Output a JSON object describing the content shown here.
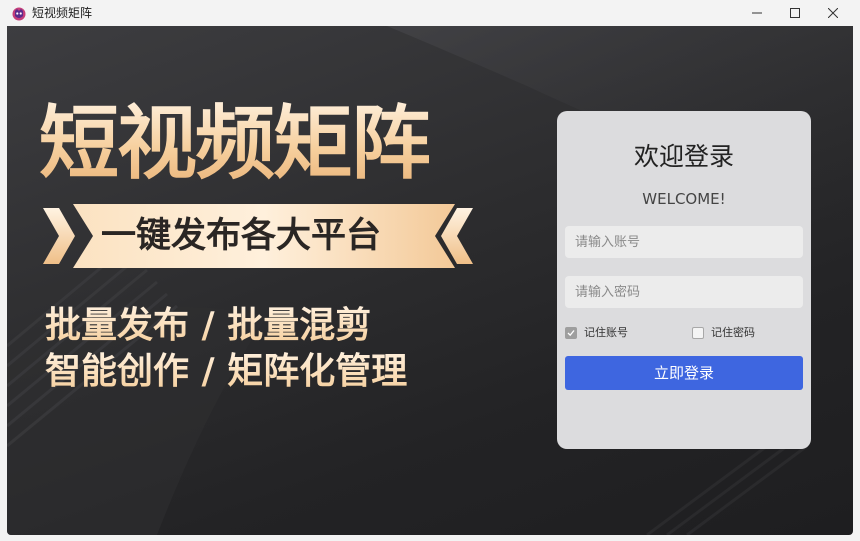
{
  "window": {
    "title": "短视频矩阵",
    "icons": [
      "app-logo-icon",
      "minimize-icon",
      "maximize-icon",
      "close-icon"
    ]
  },
  "banner": {
    "headline": "短视频矩阵",
    "ribbon": "一键发布各大平台",
    "features": [
      "批量发布 / 批量混剪",
      "智能创作 / 矩阵化管理"
    ],
    "colors": {
      "gold": "#f6cf9d",
      "background": "#2c2c2e"
    }
  },
  "login": {
    "title": "欢迎登录",
    "subtitle": "WELCOME!",
    "account_placeholder": "请输入账号",
    "password_placeholder": "请输入密码",
    "remember_account": {
      "label": "记住账号",
      "checked": true
    },
    "remember_password": {
      "label": "记住密码",
      "checked": false
    },
    "submit_label": "立即登录",
    "accent_color": "#3e66e0"
  }
}
